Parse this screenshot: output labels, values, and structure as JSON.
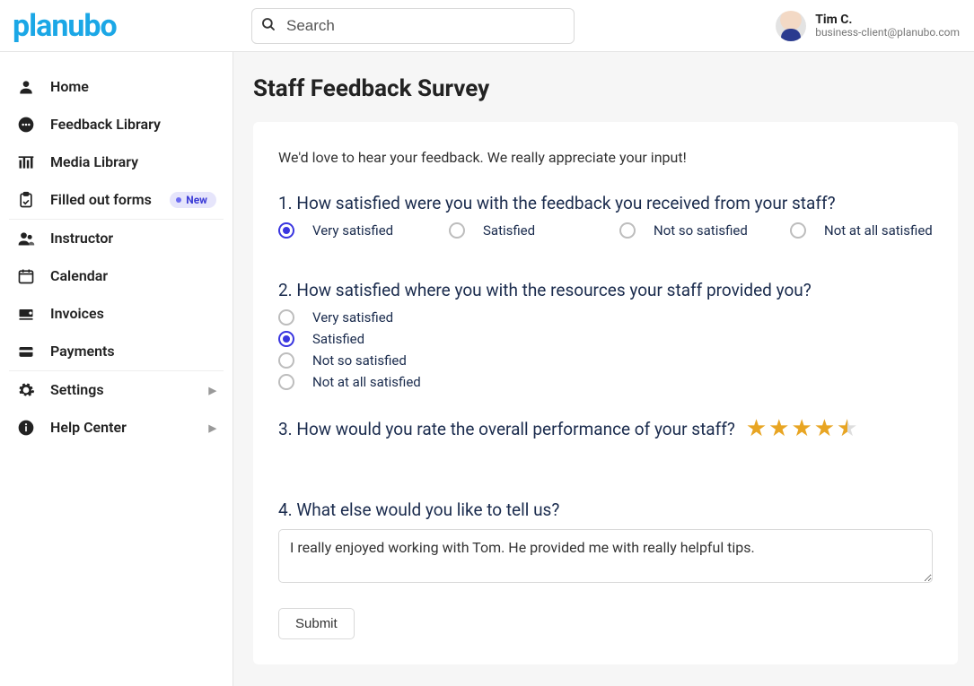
{
  "header": {
    "logo": "planubo",
    "search_placeholder": "Search",
    "user_name": "Tim C.",
    "user_email": "business-client@planubo.com"
  },
  "sidebar": {
    "items": [
      {
        "label": "Home",
        "icon": "home"
      },
      {
        "label": "Feedback Library",
        "icon": "comment"
      },
      {
        "label": "Media Library",
        "icon": "library"
      },
      {
        "label": "Filled out forms",
        "icon": "clipboard",
        "badge": "New"
      },
      {
        "label": "Instructor",
        "icon": "users",
        "sep": true
      },
      {
        "label": "Calendar",
        "icon": "calendar"
      },
      {
        "label": "Invoices",
        "icon": "invoice"
      },
      {
        "label": "Payments",
        "icon": "card"
      },
      {
        "label": "Settings",
        "icon": "gear",
        "sep": true,
        "expandable": true
      },
      {
        "label": "Help Center",
        "icon": "info",
        "expandable": true
      }
    ]
  },
  "page": {
    "title": "Staff Feedback Survey",
    "intro": "We'd love to hear your feedback. We really appreciate your input!",
    "q1": {
      "text": "1. How satisfied were you with the feedback you received from your staff?",
      "options": [
        "Very satisfied",
        "Satisfied",
        "Not so satisfied",
        "Not at all satisfied"
      ],
      "selected": 0
    },
    "q2": {
      "text": "2. How satisfied where you with the resources your staff provided you?",
      "options": [
        "Very satisfied",
        "Satisfied",
        "Not so satisfied",
        "Not at all satisfied"
      ],
      "selected": 1
    },
    "q3": {
      "text": "3. How would you rate the overall performance of your staff?",
      "rating": 4.5,
      "max": 5
    },
    "q4": {
      "text": "4. What else would you like to tell us?",
      "value": "I really enjoyed working with Tom. He provided me with really helpful tips."
    },
    "submit": "Submit"
  }
}
